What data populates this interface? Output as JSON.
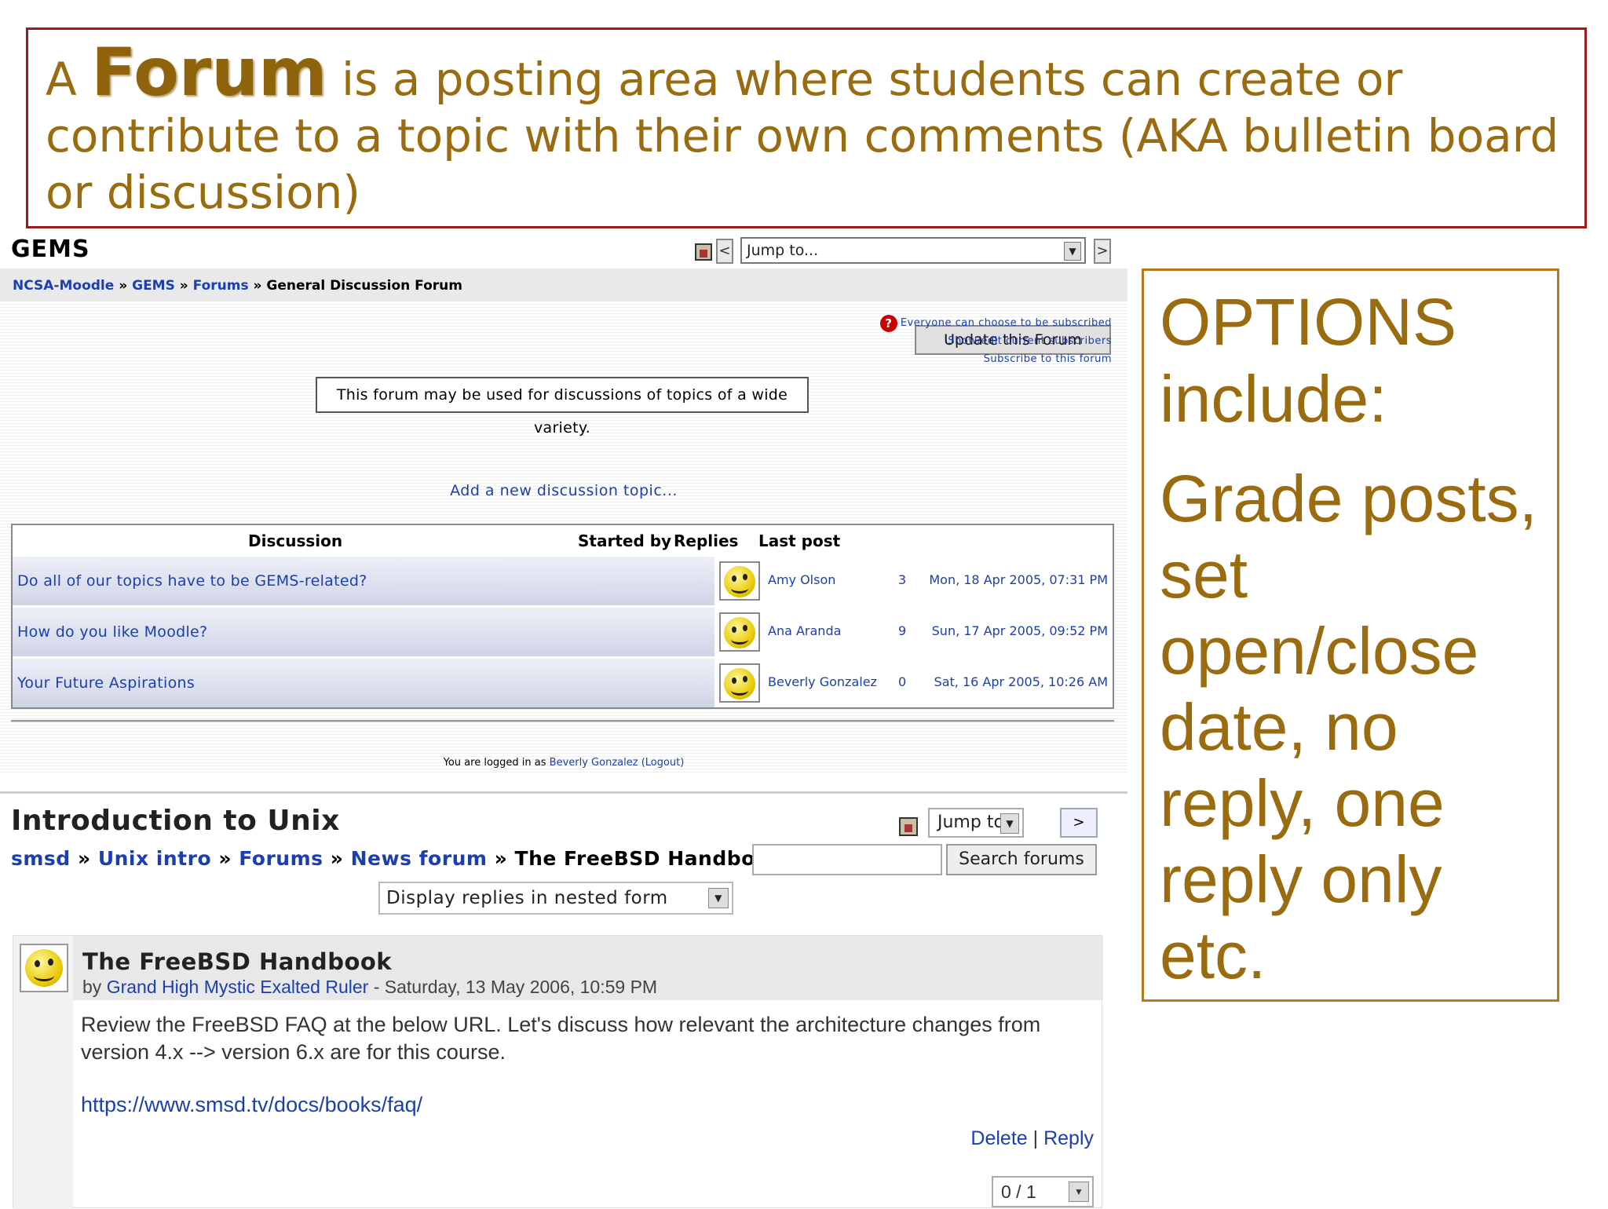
{
  "slide": {
    "title_a": "A",
    "title_forum": "Forum",
    "title_rest": " is a posting area where students can create or contribute to a topic with their own comments (AKA bulletin board or discussion)",
    "options_heading": "OPTIONS include:",
    "options_body": "Grade posts, set open/close date, no reply, one reply only etc.",
    "title_color": "#9a6b0f",
    "title_border_color": "#9b1b1b",
    "options_border_color": "#b47b1e"
  },
  "gems": {
    "course_title": "GEMS",
    "prev_label": "<",
    "next_label": ">",
    "jump_to": "Jump to...",
    "breadcrumb": {
      "item1": "NCSA-Moodle",
      "item2": "GEMS",
      "item3": "Forums",
      "current": "General Discussion Forum",
      "sep": "»"
    },
    "update_button": "Update this Forum",
    "subscription": {
      "line1": "Everyone can choose to be subscribed",
      "line2": "Show/edit current subscribers",
      "line3": "Subscribe to this forum"
    },
    "intro": "This forum may be used for discussions of topics of a wide variety.",
    "add_topic": "Add a new discussion topic...",
    "table": {
      "headers": {
        "discussion": "Discussion",
        "started_by": "Started by",
        "replies": "Replies",
        "last_post": "Last post"
      },
      "rows": [
        {
          "discussion": "Do all of our topics have to be GEMS-related?",
          "author": "Amy Olson",
          "replies": "3",
          "last_post": "Mon, 18 Apr 2005, 07:31 PM"
        },
        {
          "discussion": "How do you like Moodle?",
          "author": "Ana Aranda",
          "replies": "9",
          "last_post": "Sun, 17 Apr 2005, 09:52 PM"
        },
        {
          "discussion": "Your Future Aspirations",
          "author": "Beverly Gonzalez",
          "replies": "0",
          "last_post": "Sat, 16 Apr 2005, 10:26 AM"
        }
      ]
    },
    "login": {
      "prefix": "You are logged in as ",
      "user": "Beverly Gonzalez",
      "logout": "(Logout)"
    }
  },
  "unix": {
    "course_title": "Introduction to Unix",
    "jump_to": "Jump to...",
    "go_label": ">",
    "breadcrumb": {
      "item1": "smsd",
      "item2": "Unix intro",
      "item3": "Forums",
      "item4": "News forum",
      "current": "The FreeBSD Handbook",
      "sep": "»"
    },
    "help_label": "?",
    "search_button": "Search forums",
    "display_mode": "Display replies in nested form",
    "post": {
      "subject": "The FreeBSD Handbook",
      "by_prefix": "by ",
      "author": "Grand High Mystic Exalted Ruler",
      "date": " - Saturday, 13 May 2006, 10:59 PM",
      "body": "Review the FreeBSD FAQ at the below URL. Let's discuss how relevant the architecture changes from version 4.x --> version 6.x are for this course.",
      "url": "https://www.smsd.tv/docs/books/faq/",
      "delete": "Delete",
      "divider": " | ",
      "reply": "Reply",
      "rating": "0 / 1"
    }
  }
}
